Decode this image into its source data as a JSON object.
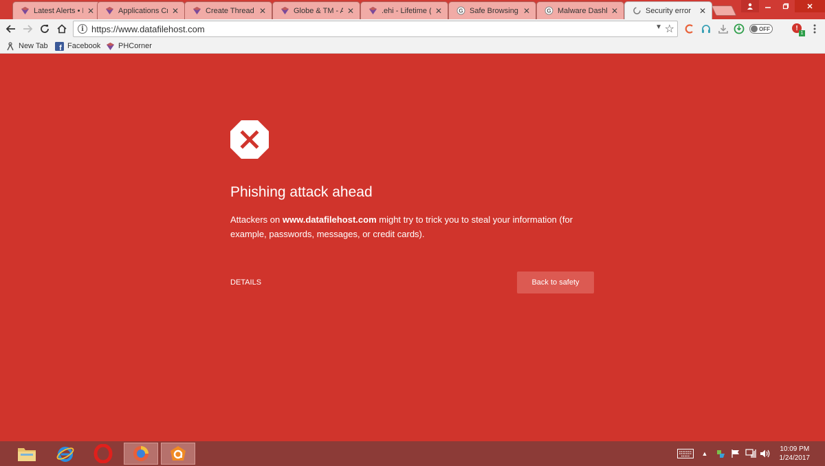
{
  "tabs": [
    {
      "title": "Latest Alerts • P",
      "close": "✕"
    },
    {
      "title": "Applications Cr",
      "close": "✕"
    },
    {
      "title": "Create Thread -",
      "close": "✕"
    },
    {
      "title": "Globe & TM - A",
      "close": "✕"
    },
    {
      "title": ".ehi - Lifetime (c",
      "close": "✕"
    },
    {
      "title": "Safe Browsing -",
      "close": "✕"
    },
    {
      "title": "Malware Dashb",
      "close": "✕"
    },
    {
      "title": "Security error",
      "close": "✕"
    }
  ],
  "toolbar": {
    "url": "https://www.datafilehost.com",
    "toggle_label": "OFF",
    "badge_count": "1"
  },
  "bookmarks": [
    {
      "label": "New Tab"
    },
    {
      "label": "Facebook"
    },
    {
      "label": "PHCorner"
    }
  ],
  "interstitial": {
    "heading": "Phishing attack ahead",
    "desc_prefix": "Attackers on ",
    "desc_domain": "www.datafilehost.com",
    "desc_suffix": " might try to trick you to steal your information (for example, passwords, messages, or credit cards).",
    "details_label": "DETAILS",
    "back_label": "Back to safety"
  },
  "taskbar": {
    "time": "10:09 PM",
    "date": "1/24/2017"
  },
  "colors": {
    "danger_red": "#d0342c",
    "button_red": "#dc5a52"
  }
}
